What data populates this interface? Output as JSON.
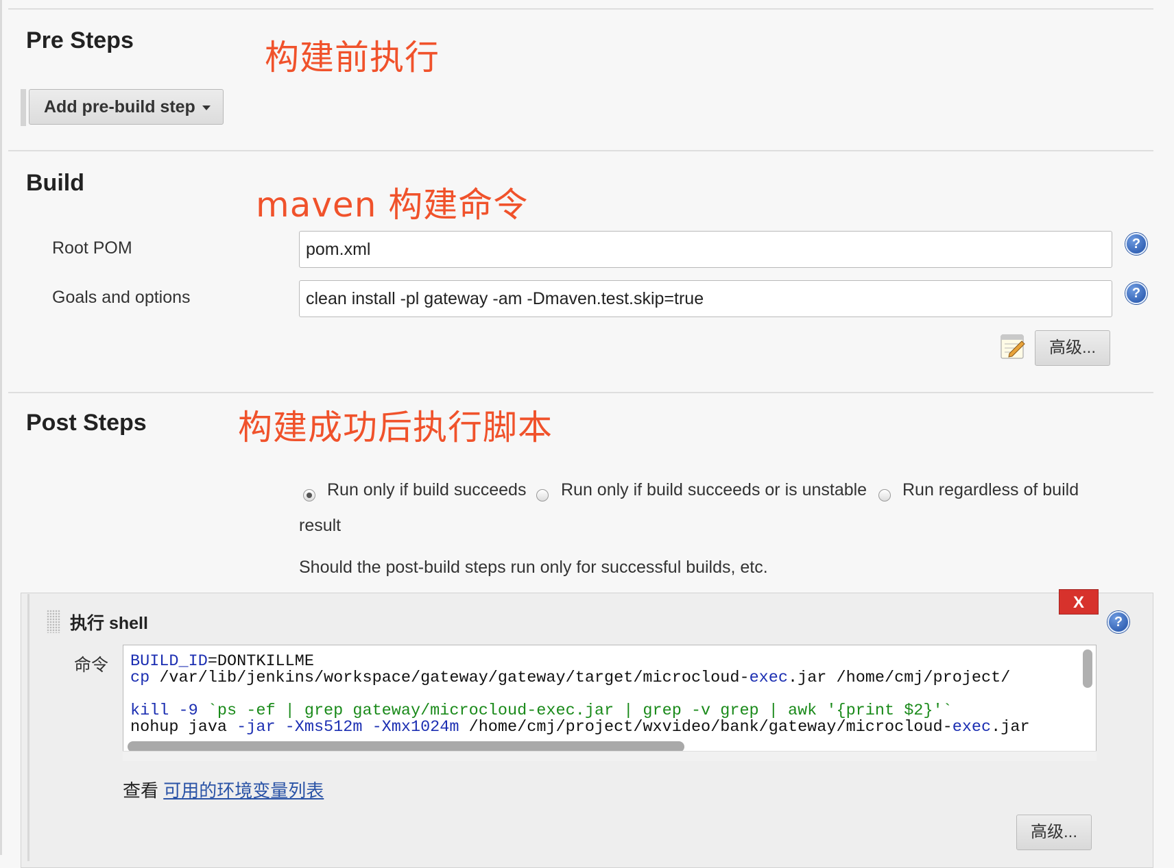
{
  "pre_steps": {
    "title": "Pre Steps",
    "annotation": "构建前执行",
    "add_button": "Add pre-build step"
  },
  "build": {
    "title": "Build",
    "annotation": "maven 构建命令",
    "root_pom_label": "Root POM",
    "root_pom_value": "pom.xml",
    "goals_label": "Goals and options",
    "goals_value": "clean install -pl gateway -am -Dmaven.test.skip=true",
    "advanced_button": "高级..."
  },
  "post_steps": {
    "title": "Post Steps",
    "annotation": "构建成功后执行脚本",
    "radio_options": [
      {
        "label": "Run only if build succeeds",
        "checked": true
      },
      {
        "label": "Run only if build succeeds or is unstable",
        "checked": false
      },
      {
        "label": "Run regardless of build",
        "checked": false
      }
    ],
    "radio_wrap": "result",
    "description": "Should the post-build steps run only for successful builds, etc.",
    "shell_panel": {
      "title": "执行 shell",
      "close_label": "X",
      "command_label": "命令",
      "code_lines": [
        "BUILD_ID=DONTKILLME",
        "cp /var/lib/jenkins/workspace/gateway/gateway/target/microcloud-exec.jar /home/cmj/project/",
        "",
        "kill -9 `ps -ef | grep gateway/microcloud-exec.jar | grep -v grep | awk '{print $2}'`",
        "nohup java -jar -Xms512m -Xmx1024m /home/cmj/project/wxvideo/bank/gateway/microcloud-exec.jar"
      ],
      "env_prefix": "查看",
      "env_link": "可用的环境变量列表",
      "advanced_button": "高级..."
    }
  },
  "icons": {
    "help": "help-icon",
    "notepad": "notepad-icon",
    "dropdown": "caret-down-icon"
  },
  "colors": {
    "annotation": "#f0522b",
    "help_blue": "#1f4fa6",
    "close_red": "#d7322c",
    "link": "#2a53a6"
  }
}
